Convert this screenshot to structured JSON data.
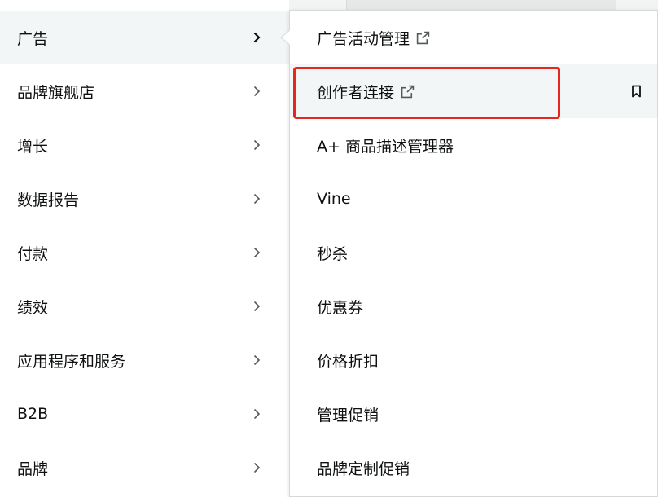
{
  "left_menu": {
    "items": [
      {
        "label": "广告"
      },
      {
        "label": "品牌旗舰店"
      },
      {
        "label": "增长"
      },
      {
        "label": "数据报告"
      },
      {
        "label": "付款"
      },
      {
        "label": "绩效"
      },
      {
        "label": "应用程序和服务"
      },
      {
        "label": "B2B"
      },
      {
        "label": "品牌"
      }
    ]
  },
  "submenu": {
    "items": [
      {
        "label": "广告活动管理"
      },
      {
        "label": "创作者连接"
      },
      {
        "label": "A+ 商品描述管理器"
      },
      {
        "label": "Vine"
      },
      {
        "label": "秒杀"
      },
      {
        "label": "优惠券"
      },
      {
        "label": "价格折扣"
      },
      {
        "label": "管理促销"
      },
      {
        "label": "品牌定制促销"
      }
    ]
  },
  "colors": {
    "highlight": "#e8251e",
    "active_bg": "#f3f6f6",
    "chevron": "#565959"
  }
}
